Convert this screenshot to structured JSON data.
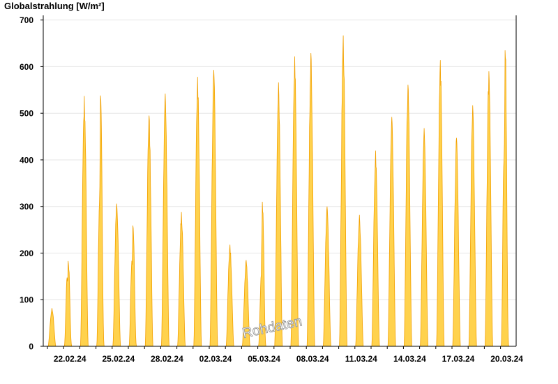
{
  "chart_data": {
    "type": "area",
    "ylabel": "Globalstrahlung [W/m²]",
    "ylim": [
      0,
      710
    ],
    "yticks": [
      0,
      100,
      200,
      300,
      400,
      500,
      600,
      700
    ],
    "xticks": [
      "22.02.24",
      "25.02.24",
      "28.02.24",
      "02.03.24",
      "05.03.24",
      "08.03.24",
      "11.03.24",
      "14.03.24",
      "17.03.24",
      "20.03.24"
    ],
    "x_start_date": "21.02.24",
    "grid": "horizontal",
    "colors": {
      "fill": "#ffd24d",
      "line": "#f2a000",
      "axis": "#000000",
      "grid": "#e6e6e6"
    },
    "series": [
      {
        "values": [
          {
            "date": "21.02.24",
            "peak": 82,
            "shape": "single"
          },
          {
            "date": "22.02.24",
            "peak": 183,
            "shape": "double",
            "secondary": 150
          },
          {
            "date": "23.02.24",
            "peak": 537,
            "shape": "single",
            "secondary": 425
          },
          {
            "date": "24.02.24",
            "peak": 538,
            "shape": "double",
            "secondary": 310
          },
          {
            "date": "25.02.24",
            "peak": 306,
            "shape": "single"
          },
          {
            "date": "26.02.24",
            "peak": 259,
            "shape": "double",
            "secondary": 190
          },
          {
            "date": "27.02.24",
            "peak": 495,
            "shape": "single"
          },
          {
            "date": "28.02.24",
            "peak": 542,
            "shape": "single"
          },
          {
            "date": "29.02.24",
            "peak": 288,
            "shape": "single"
          },
          {
            "date": "01.03.24",
            "peak": 578,
            "shape": "single"
          },
          {
            "date": "02.03.24",
            "peak": 593,
            "shape": "single"
          },
          {
            "date": "03.03.24",
            "peak": 218,
            "shape": "single"
          },
          {
            "date": "04.03.24",
            "peak": 185,
            "shape": "single"
          },
          {
            "date": "05.03.24",
            "peak": 310,
            "shape": "double",
            "secondary": 155
          },
          {
            "date": "06.03.24",
            "peak": 566,
            "shape": "single"
          },
          {
            "date": "07.03.24",
            "peak": 622,
            "shape": "single"
          },
          {
            "date": "08.03.24",
            "peak": 629,
            "shape": "single"
          },
          {
            "date": "09.03.24",
            "peak": 300,
            "shape": "single"
          },
          {
            "date": "10.03.24",
            "peak": 667,
            "shape": "single"
          },
          {
            "date": "11.03.24",
            "peak": 282,
            "shape": "single"
          },
          {
            "date": "12.03.24",
            "peak": 420,
            "shape": "single"
          },
          {
            "date": "13.03.24",
            "peak": 492,
            "shape": "single",
            "secondary": 375
          },
          {
            "date": "14.03.24",
            "peak": 561,
            "shape": "single"
          },
          {
            "date": "15.03.24",
            "peak": 468,
            "shape": "single"
          },
          {
            "date": "16.03.24",
            "peak": 614,
            "shape": "single"
          },
          {
            "date": "17.03.24",
            "peak": 447,
            "shape": "single"
          },
          {
            "date": "18.03.24",
            "peak": 517,
            "shape": "single"
          },
          {
            "date": "19.03.24",
            "peak": 590,
            "shape": "single"
          },
          {
            "date": "20.03.24",
            "peak": 635,
            "shape": "double",
            "secondary": 430
          }
        ]
      }
    ]
  },
  "watermark": "Rohdaten"
}
